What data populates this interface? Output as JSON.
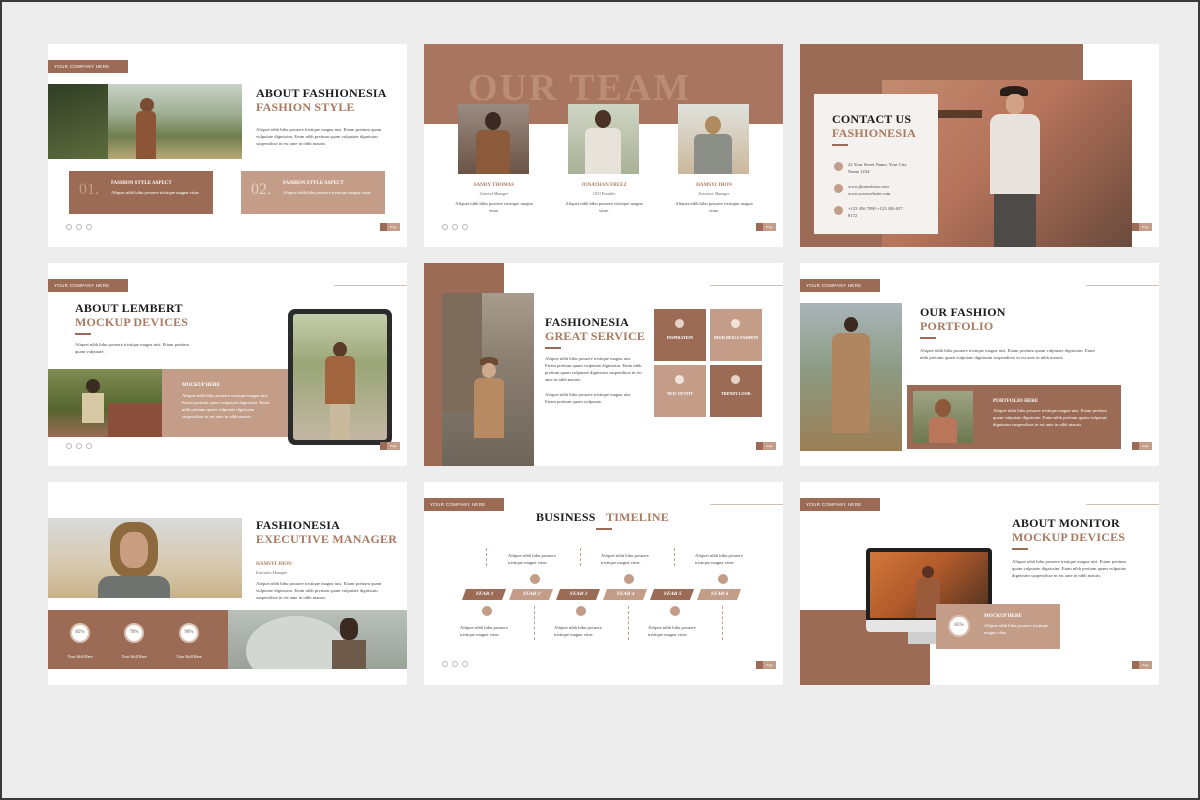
{
  "common": {
    "company_tag": "YOUR COMPANY HERE",
    "page_label": "Page",
    "lorem_long": "Aliquet nibh bibu posuere tristique magna nisi. Etiam pretium quam vulputate dignissim. Enim nibh pretium quam vulputate dignissim suspendisse in est ante in nibh mauris.",
    "lorem_short": "Aliquet nibh bibu posuere tristique magna nisi. Etiam pretium quam vulputate.",
    "lorem_tiny": "Aliquet nibh bibu posuere tristique magna vitae."
  },
  "colors": {
    "brown": "#9b6b55",
    "light_brown": "#c49d89",
    "accent_text": "#a97a60",
    "bg": "#ededed"
  },
  "slide1": {
    "title1": "ABOUT FASHIONESIA",
    "title2": "FASHION STYLE",
    "box1_num": "01.",
    "box1_title": "FASHION STYLE ASPECT",
    "box2_num": "02.",
    "box2_title": "FASHION STYLE ASPECT"
  },
  "slide2": {
    "bg_title": "OUR TEAM",
    "members": [
      {
        "name": "SANDY THOMAS",
        "role": "General Manager"
      },
      {
        "name": "JONATHAN FREEZ",
        "role": "CEO Founder"
      },
      {
        "name": "HAMSYI JHON",
        "role": "Executive Manager"
      }
    ]
  },
  "slide3": {
    "title1": "CONTACT US",
    "title2": "FASHIONESIA",
    "address": "22 Your Street Name, Your City Name 1234",
    "email": "www.jhonexlesia.com www.yourwebsite.com",
    "phone": "+123 456 7890 +123 456 657 8172"
  },
  "slide4": {
    "title1": "ABOUT LEMBERT",
    "title2": "MOCKUP DEVICES",
    "box_title": "MOCKUP HERE"
  },
  "slide5": {
    "title1": "FASHIONESIA",
    "title2": "GREAT SERVICE",
    "tiles": [
      {
        "label": "INSPIRATION",
        "icon": "bulb-icon"
      },
      {
        "label": "HIGH HEELS FASHION",
        "icon": "heel-icon"
      },
      {
        "label": "NEW OUTFIT",
        "icon": "dress-icon"
      },
      {
        "label": "TRENDY LOOK",
        "icon": "globe-icon"
      }
    ]
  },
  "slide6": {
    "title1": "OUR FASHION",
    "title2": "PORTFOLIO",
    "box_title": "PORTFOLIO HERE"
  },
  "slide7": {
    "title1": "FASHIONESIA",
    "title2": "EXECUTIVE MANAGER",
    "person_name": "HAMSYI JHON",
    "person_role": "Executive Manager",
    "stats": [
      {
        "value": "85%",
        "label": "Your Skill Here"
      },
      {
        "value": "70%",
        "label": "Your Skill Here"
      },
      {
        "value": "90%",
        "label": "Your Skill Here"
      }
    ]
  },
  "slide8": {
    "title1": "BUSINESS",
    "title2": "TIMELINE",
    "years": [
      "YEAR 1",
      "YEAR 2",
      "YEAR 3",
      "YEAR 4",
      "YEAR 5",
      "YEAR 6"
    ]
  },
  "slide9": {
    "title1": "ABOUT MONITOR",
    "title2": "MOCKUP DEVICES",
    "stat_value": "85%",
    "box_title": "MOCKUP HERE"
  }
}
